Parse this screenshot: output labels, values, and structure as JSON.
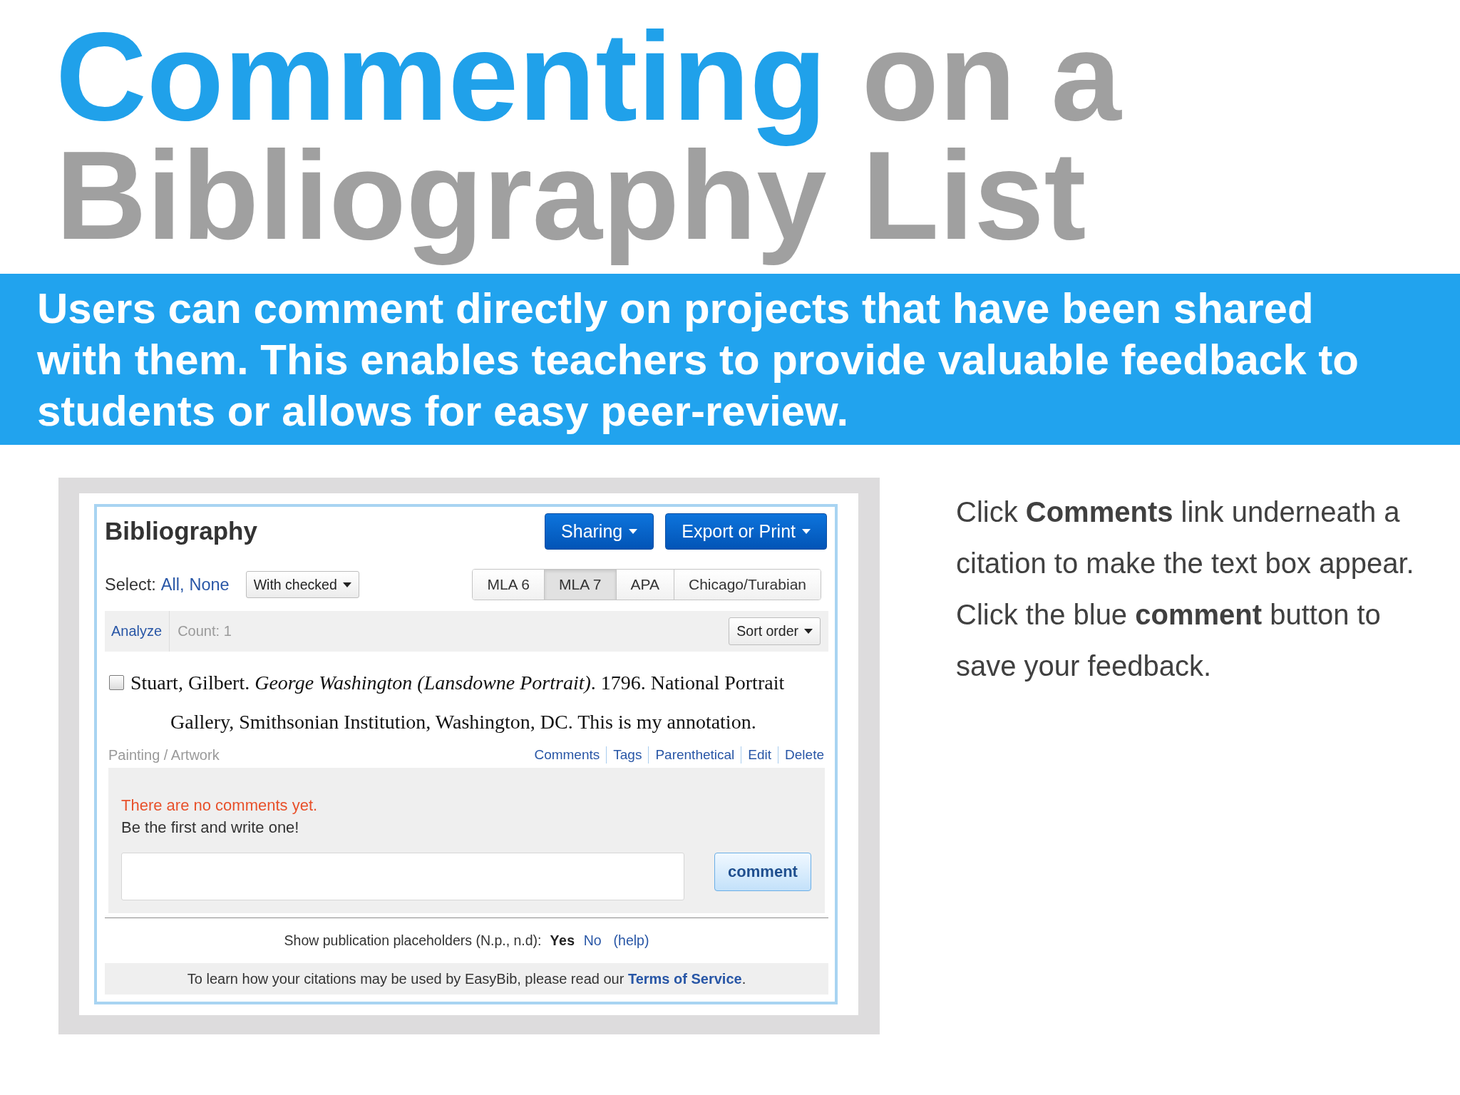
{
  "title": [
    {
      "text": "Commenting",
      "accent": true
    },
    {
      "text": "on a Bibliography List",
      "accent": false
    }
  ],
  "intro": "Users can comment directly on projects that have been shared with them. This enables teachers to provide valuable feedback to students or allows for easy peer-review.",
  "bibliography": {
    "heading": "Bibliography",
    "header_buttons": [
      "Sharing",
      "Export or Print"
    ],
    "select": {
      "label": "Select:",
      "links": [
        "All,",
        "None"
      ]
    },
    "with_checked": "With checked",
    "styles": [
      {
        "label": "MLA 6",
        "selected": false
      },
      {
        "label": "MLA 7",
        "selected": true
      },
      {
        "label": "APA",
        "selected": false
      },
      {
        "label": "Chicago/Turabian",
        "selected": false
      }
    ],
    "toolbar": {
      "analyze": "Analyze",
      "count": "Count: 1",
      "sort": "Sort order"
    },
    "citation": {
      "checked": false,
      "text": "Stuart, Gilbert. *George Washington (Lansdowne Portrait)*. 1796. National Portrait Gallery, Smithsonian Institution, Washington, DC. This is my annotation.",
      "type": "Painting / Artwork",
      "actions": [
        "Comments",
        "Tags",
        "Parenthetical",
        "Edit",
        "Delete"
      ]
    },
    "comments": {
      "empty_message": "There are no comments yet.",
      "prompt": "Be the first and write one!",
      "button": "comment"
    },
    "placeholders": {
      "label": "Show publication placeholders (N.p., n.d):",
      "options": [
        {
          "label": "Yes",
          "selected": true
        },
        {
          "label": "No",
          "selected": false
        }
      ],
      "help": "(help)"
    },
    "footer": {
      "text": "To learn how your citations may be used by EasyBib, please read our",
      "link": "Terms of Service",
      "end": "."
    }
  },
  "instructions": "Click **Comments** link underneath a citation to make the text box appear. Click the blue **comment** button to save your feedback."
}
